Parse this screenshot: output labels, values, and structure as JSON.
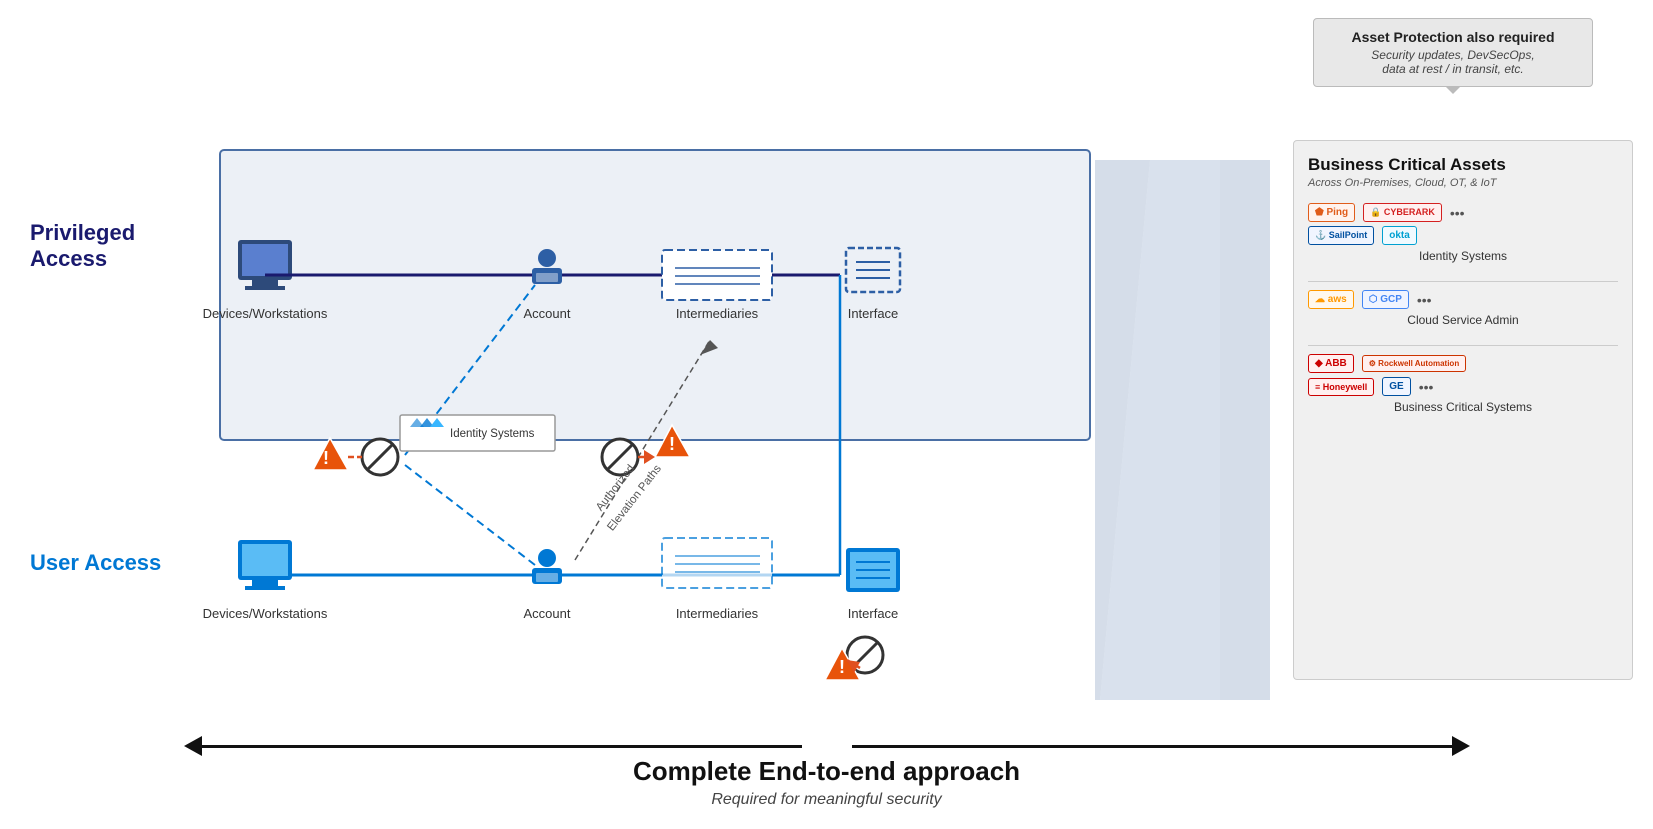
{
  "callout": {
    "title": "Asset Protection also required",
    "subtitle": "Security updates, DevSecOps,\ndata at rest / in transit, etc."
  },
  "labels": {
    "privileged_access": "Privileged Access",
    "user_access": "User Access"
  },
  "bca": {
    "title": "Business Critical Assets",
    "subtitle": "Across On-Premises, Cloud, OT, & IoT",
    "sections": [
      {
        "label": "Identity Systems",
        "logos": [
          "Ping",
          "CYBERARK",
          "SailPoint",
          "okta",
          "..."
        ]
      },
      {
        "label": "Cloud Service Admin",
        "logos": [
          "aws",
          "GCP",
          "..."
        ]
      },
      {
        "label": "Business Critical Systems",
        "logos": [
          "ABB",
          "Rockwell Automation",
          "Honeywell",
          "GE",
          "..."
        ]
      }
    ]
  },
  "privileged_row": {
    "items": [
      "Devices/Workstations",
      "Account",
      "Intermediaries",
      "Interface"
    ]
  },
  "user_row": {
    "items": [
      "Devices/Workstations",
      "Account",
      "Intermediaries",
      "Interface"
    ]
  },
  "middle": {
    "identity_systems_label": "Identity Systems",
    "authorized_elevation": "Authorized\nElevation Paths",
    "intermediaries_floating": "Intermediaries"
  },
  "bottom": {
    "title": "Complete End-to-end approach",
    "subtitle": "Required for meaningful security"
  }
}
